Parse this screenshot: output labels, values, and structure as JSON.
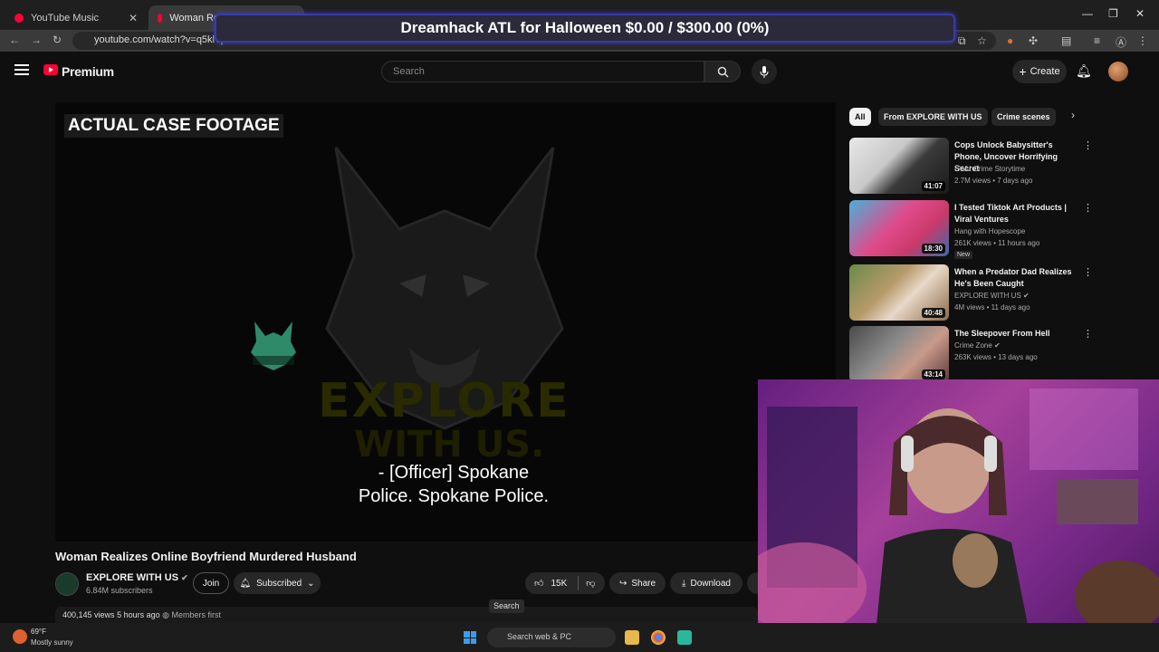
{
  "browser": {
    "tabs": [
      {
        "title": "YouTube Music"
      },
      {
        "title": "Woman Realizes Online Boyfriend Murdered Husband"
      }
    ],
    "url": "youtube.com/watch?v=q5klTpYM"
  },
  "banner": {
    "text": "Dreamhack ATL for Halloween $0.00 / $300.00 (0%)"
  },
  "youtube": {
    "brand": "Premium",
    "search_placeholder": "Search",
    "create_label": "Create"
  },
  "player": {
    "case_label": "ACTUAL CASE FOOTAGE",
    "subtitle_line1": "- [Officer] Spokane",
    "subtitle_line2": "Police. Spokane Police."
  },
  "video": {
    "title": "Woman Realizes Online Boyfriend Murdered Husband",
    "channel": "EXPLORE WITH US",
    "subscribers": "6.84M subscribers",
    "join_label": "Join",
    "subscribed_label": "Subscribed",
    "likes": "15K",
    "share_label": "Share",
    "download_label": "Download",
    "views": "400,145 views",
    "age": "5 hours ago",
    "members": "Members first",
    "tooltip": "Search"
  },
  "chips": [
    "All",
    "From EXPLORE WITH US",
    "Crime scenes"
  ],
  "recommendations": [
    {
      "title": "Cops Unlock Babysitter's Phone, Uncover Horrifying Secret",
      "channel": "EWU Crime Storytime",
      "meta": "2.7M views • 7 days ago",
      "duration": "41:07",
      "badge": ""
    },
    {
      "title": "I Tested Tiktok Art Products | Viral Ventures",
      "channel": "Hang with Hopescope",
      "meta": "261K views • 11 hours ago",
      "duration": "18:30",
      "badge": "New"
    },
    {
      "title": "When a Predator Dad Realizes He's Been Caught",
      "channel": "EXPLORE WITH US",
      "meta": "4M views • 11 days ago",
      "duration": "40:48",
      "badge": ""
    },
    {
      "title": "The Sleepover From Hell",
      "channel": "Crime Zone",
      "meta": "263K views • 13 days ago",
      "duration": "43:14",
      "badge": ""
    }
  ],
  "taskbar": {
    "temp": "69°F",
    "weather": "Mostly sunny",
    "search_placeholder": "Search web & PC"
  },
  "colors": {
    "accent": "#ff0033",
    "banner_border": "#3a3aa8"
  }
}
